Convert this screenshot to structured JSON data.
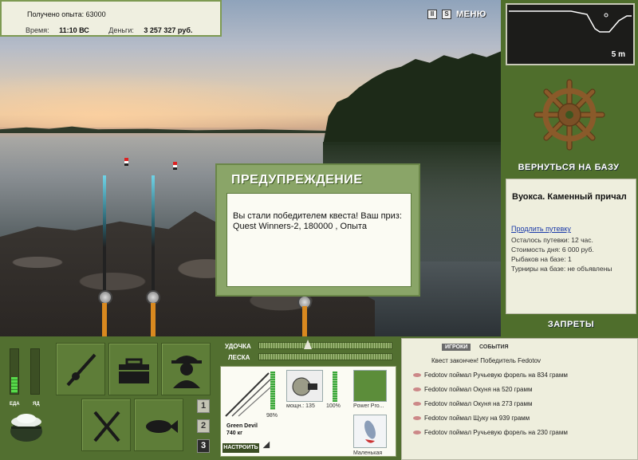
{
  "info": {
    "experience_label": "Получено опыта:",
    "experience_value": "63000",
    "time_label": "Время:",
    "time_value": "11:10 ВС",
    "money_label": "Деньги:",
    "money_value": "3 257 327 руб."
  },
  "topbar": {
    "pause_glyph": "II",
    "s_glyph": "S",
    "menu_label": "МЕНЮ"
  },
  "minimap": {
    "depth": "5 m"
  },
  "base": {
    "return_label": "ВЕРНУТЬСЯ НА БАЗУ",
    "name": "Вуокса. Каменный причал",
    "extend_link": "Продлить путевку",
    "lines": [
      "Осталось путевки: 12 час.",
      "Стоимость дня: 6 000 руб.",
      "Рыбаков на базе: 1",
      "Турниры на базе: не объявлены"
    ],
    "bans_label": "ЗАПРЕТЫ"
  },
  "dialog": {
    "title": "ПРЕДУПРЕЖДЕНИЕ",
    "message": "Вы стали победителем квеста! Ваш приз: Quest Winners-2, 180000 , Опыта"
  },
  "status": {
    "food_label": "ЕДА",
    "poison_label": "ЯД",
    "food_level": 0.35,
    "poison_level": 0.0
  },
  "rod_select": [
    "1",
    "2",
    "3"
  ],
  "rod_select_active": 2,
  "tackle": {
    "rod_slider_label": "УДОЧКА",
    "line_slider_label": "ЛЕСКА",
    "rod_name": "Green Devil",
    "rod_weight": "740 кг",
    "rod_percent": "98%",
    "reel_power": "мощн.: 135",
    "reel_percent": "100%",
    "line_name": "Power Pro...",
    "lure_name": "Маленькая",
    "setup_label": "НАСТРОИТЬ"
  },
  "events": {
    "tab_players": "ИГРОКИ",
    "tab_events": "СОБЫТИЯ",
    "header": "Квест закончен! Победитель Fedotov",
    "items": [
      "Fedotov поймал Ручьевую форель на 834 грамм",
      "Fedotov поймал Окуня на 520 грамм",
      "Fedotov поймал Окуня на 273 грамм",
      "Fedotov поймал Щуку на 939 грамм",
      "Fedotov поймал Ручьевую форель на 230 грамм"
    ]
  },
  "colors": {
    "panel_green": "#526f30",
    "accent_green": "#4f6e2c",
    "panel_cream": "#eeeedd",
    "link_blue": "#1a39a8"
  }
}
